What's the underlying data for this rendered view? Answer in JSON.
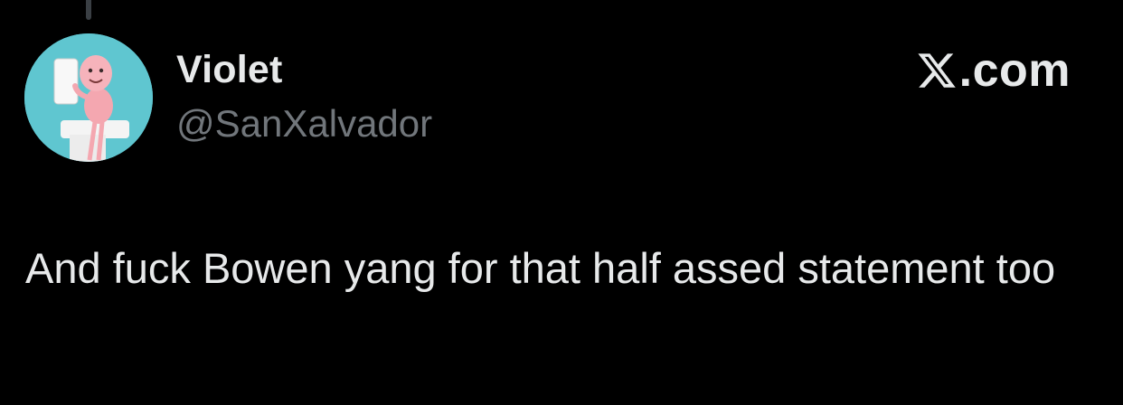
{
  "tweet": {
    "author": {
      "display_name": "Violet",
      "handle": "@SanXalvador",
      "avatar_icon": "cartoon-character-avatar"
    },
    "brand": {
      "icon": "x-logo-icon",
      "text": ".com"
    },
    "text": "And fuck Bowen yang for that half assed statement too"
  },
  "colors": {
    "background": "#000000",
    "primary_text": "#e7e9ea",
    "secondary_text": "#71767b",
    "avatar_background": "#5fc6d0"
  }
}
